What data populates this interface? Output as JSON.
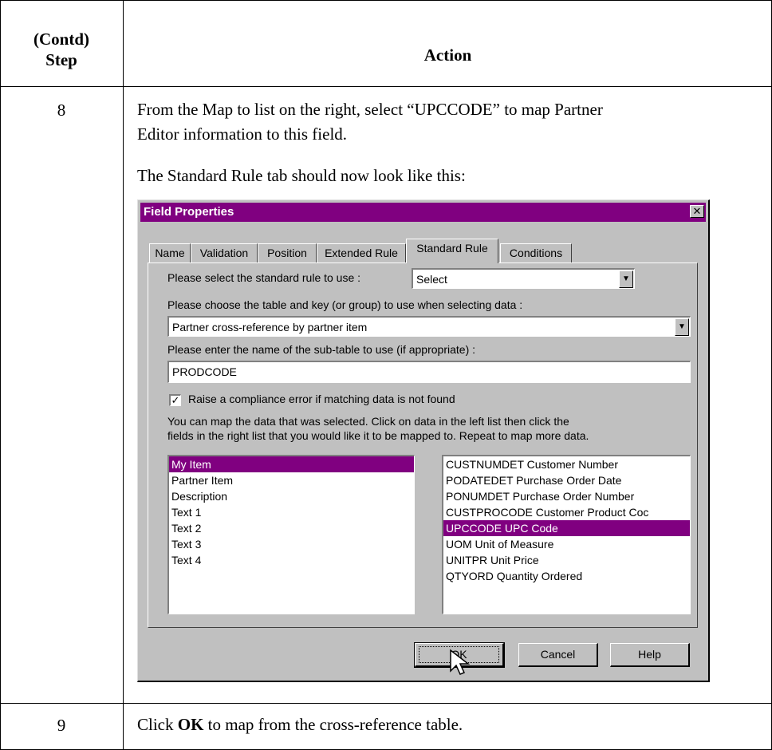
{
  "table": {
    "header_step_line1": "(Contd)",
    "header_step_line2": "Step",
    "header_action": "Action"
  },
  "steps": [
    {
      "number": "8",
      "text_line1": "From the Map to list on the right, select “UPCCODE” to map Partner",
      "text_line2": "Editor information to this field.",
      "text_line3": "The Standard Rule tab should now look like this:"
    },
    {
      "number": "9",
      "text_prefix": "Click ",
      "text_bold": "OK",
      "text_suffix": " to map from the cross-reference table."
    }
  ],
  "dialog": {
    "title": "Field Properties",
    "close_glyph": "✕",
    "tabs": [
      "Name",
      "Validation",
      "Position",
      "Extended Rule",
      "Standard Rule",
      "Conditions"
    ],
    "active_tab": "Standard Rule",
    "rule_label": "Please select the standard rule to use :",
    "rule_value": "Select",
    "table_label": "Please choose the table and key (or group) to use when selecting data :",
    "table_value": "Partner cross-reference by partner item",
    "subtable_label": "Please enter the name of the sub-table to use (if appropriate) :",
    "subtable_value": "PRODCODE",
    "compliance_checked": true,
    "compliance_label": "Raise a compliance error if matching data is not found",
    "map_help_line1": "You can map the data that was selected. Click on data in the left list then click the",
    "map_help_line2": "fields in the right list that you would like it to be mapped to. Repeat to map more data.",
    "left_list": [
      "My Item",
      "Partner Item",
      "Description",
      "Text 1",
      "Text 2",
      "Text 3",
      "Text 4"
    ],
    "left_selected": "My Item",
    "right_list": [
      "CUSTNUMDET Customer Number",
      "PODATEDET Purchase Order Date",
      "PONUMDET Purchase Order Number",
      "CUSTPROCODE Customer Product Coc",
      "UPCCODE UPC Code",
      "UOM Unit of Measure",
      "UNITPR Unit Price",
      "QTYORD Quantity Ordered"
    ],
    "right_selected": "UPCCODE UPC Code",
    "ok_label": "OK",
    "cancel_label": "Cancel",
    "help_label": "Help",
    "check_glyph": "✓",
    "dropdown_glyph": "▼"
  }
}
